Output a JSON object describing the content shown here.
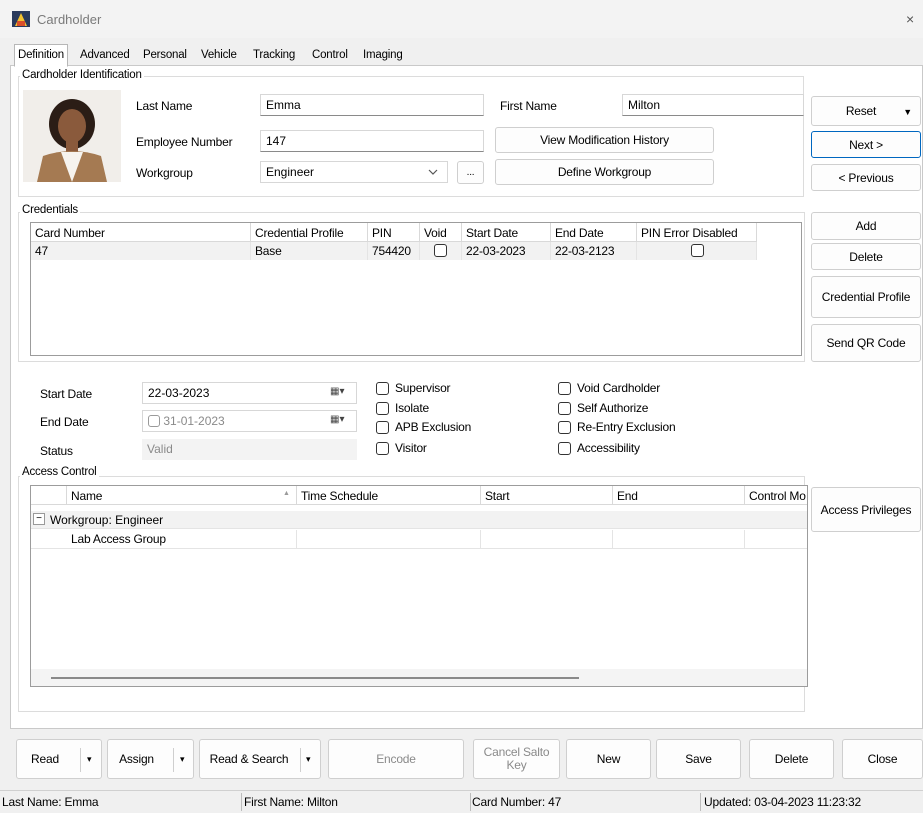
{
  "window": {
    "title": "Cardholder",
    "close_glyph": "×"
  },
  "tabs": [
    {
      "label": "Definition",
      "active": true
    },
    {
      "label": "Advanced"
    },
    {
      "label": "Personal"
    },
    {
      "label": "Vehicle"
    },
    {
      "label": "Tracking"
    },
    {
      "label": "Control"
    },
    {
      "label": "Imaging"
    }
  ],
  "identification": {
    "group_label": "Cardholder Identification",
    "last_name_label": "Last Name",
    "last_name_value": "Emma",
    "first_name_label": "First Name",
    "first_name_value": "Milton",
    "employee_number_label": "Employee Number",
    "employee_number_value": "147",
    "workgroup_label": "Workgroup",
    "workgroup_value": "Engineer",
    "browse_label": "...",
    "view_history_label": "View Modification History",
    "define_workgroup_label": "Define Workgroup"
  },
  "side_buttons": {
    "reset": "Reset",
    "next": "Next >",
    "previous": "< Previous",
    "add": "Add",
    "delete": "Delete",
    "credential_profile": "Credential Profile",
    "send_qr": "Send QR Code",
    "access_privileges": "Access Privileges"
  },
  "credentials": {
    "group_label": "Credentials",
    "columns": [
      "Card Number",
      "Credential Profile",
      "PIN",
      "Void",
      "Start Date",
      "End Date",
      "PIN Error Disabled"
    ],
    "rows": [
      {
        "card_number": "47",
        "profile": "Base",
        "pin": "754420",
        "void": false,
        "start": "22-03-2023",
        "end": "22-03-2123",
        "pin_error_disabled": false
      }
    ]
  },
  "dates": {
    "start_label": "Start Date",
    "start_value": "22-03-2023",
    "end_label": "End Date",
    "end_value": "31-01-2023",
    "status_label": "Status",
    "status_value": "Valid"
  },
  "options": {
    "col1": [
      {
        "label": "Supervisor",
        "checked": false
      },
      {
        "label": "Isolate",
        "checked": false
      },
      {
        "label": "APB Exclusion",
        "checked": false
      },
      {
        "label": "Visitor",
        "checked": false
      }
    ],
    "col2": [
      {
        "label": "Void Cardholder",
        "checked": false
      },
      {
        "label": "Self Authorize",
        "checked": false
      },
      {
        "label": "Re-Entry Exclusion",
        "checked": false
      },
      {
        "label": "Accessibility",
        "checked": false
      }
    ]
  },
  "access": {
    "group_label": "Access Control",
    "columns": [
      "Name",
      "Time Schedule",
      "Start",
      "End",
      "Control Mo"
    ],
    "group_row": "Workgroup: Engineer",
    "collapse_glyph": "−",
    "sort_glyph": "▲",
    "item_row": "Lab Access Group"
  },
  "bottom": {
    "read": "Read",
    "assign": "Assign",
    "read_search": "Read & Search",
    "encode": "Encode",
    "cancel_salto": "Cancel Salto Key",
    "new": "New",
    "save": "Save",
    "delete": "Delete",
    "close": "Close"
  },
  "status": {
    "last_name": "Last Name: Emma",
    "first_name": "First Name: Milton",
    "card_number": "Card Number: 47",
    "updated": "Updated: 03-04-2023 11:23:32"
  },
  "colors": {
    "accent": "#0067c0",
    "selected_row": "#f2f2f2"
  }
}
